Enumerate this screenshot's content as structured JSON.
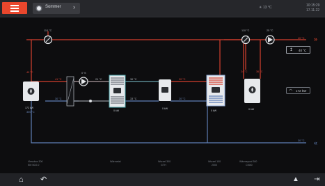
{
  "topbar": {
    "mode_label": "Sommer",
    "status_temp": "☀ 13 °C",
    "status_time": "10:15:29",
    "status_date": "17.11.22"
  },
  "diagram": {
    "temps": {
      "top_left_sensor": "110 °C",
      "top_mid_sensor": "110 °C",
      "top_right_sensor_a": "110 °C",
      "top_right_sensor_b": "25 °C",
      "top_right_out": "40 °C",
      "left_supply": "40 °C",
      "hx_red": "41 °C",
      "pump1": "0 %",
      "buffer_in_left": "24 °C",
      "buffer_out_right": "36 °C",
      "buffer_bottom_right": "33 °C",
      "mid_blue": "30 °C",
      "storage_red": "20 °C",
      "storage_blue": "20 °C",
      "right_red_a": "24 °C",
      "right_red_b": "36 °C",
      "return_right": "30 °C",
      "left_return": "30 °C"
    },
    "devices": {
      "boiler_power": "172 kW",
      "boiler_temp": "300 °C",
      "buffer_power": "0 kW",
      "unit2_power": "0 kW",
      "storage_power": "0 kW",
      "unit4_power": "0 kW"
    },
    "setpoint": "40 °C",
    "flow": "172 kW",
    "bottom_labels": [
      [
        "Viessbox 300",
        "EM 50/2.0"
      ],
      [
        "Wärmetal"
      ],
      [
        "Wurzel 300",
        "GTH"
      ],
      [
        "Wurzel 100",
        "2000"
      ],
      [
        "Wärmepool 300",
        "CM40"
      ]
    ]
  },
  "colors": {
    "accent": "#e9472d",
    "supply": "#d6402f",
    "return": "#5f7fb6",
    "neutral": "#9aa0a8"
  }
}
